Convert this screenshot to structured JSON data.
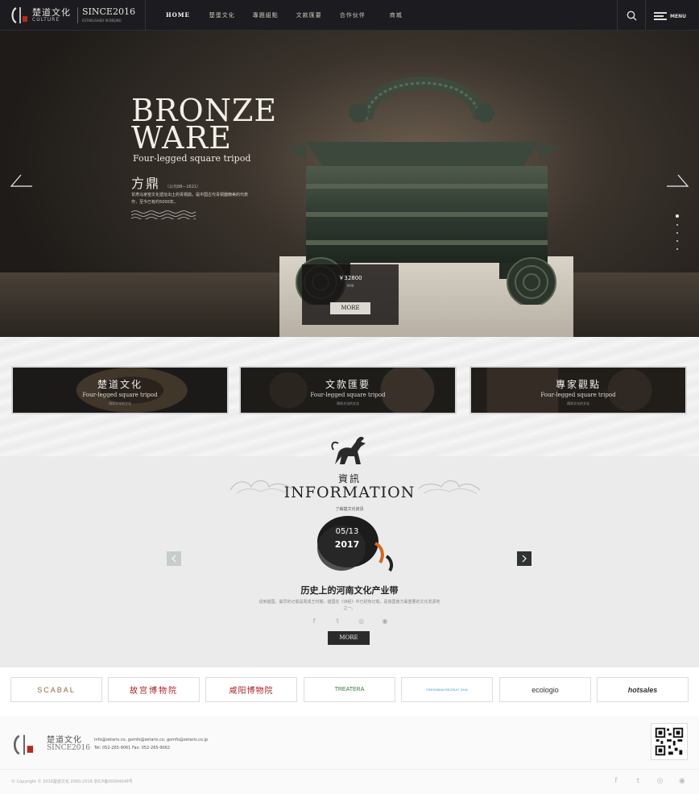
{
  "header": {
    "logo_cn": "楚道文化",
    "logo_en": "CULTURE",
    "logo_since": "SINCE2016",
    "logo_since_sub": "ESTABLISHED IN BEIJING",
    "nav": [
      {
        "label": "HOME",
        "active": true
      },
      {
        "label": "楚蛋文化"
      },
      {
        "label": "專題組點"
      },
      {
        "label": "文款匯要"
      },
      {
        "label": "合作伙伴"
      },
      {
        "label": "商城"
      }
    ],
    "search_icon": "search-icon",
    "menu_label": "MENU"
  },
  "hero": {
    "title_line1": "BRONZE",
    "title_line2": "WARE",
    "subtitle": "Four-legged square tripod",
    "name_cn": "方鼎",
    "period": "（公元88—1621）",
    "description": "甘肃马家窑文化遗址出土的青铜鼎，是中国古代青铜器精美的代表作，至今已有约5000年。",
    "price": "￥32800",
    "price_unit": "RMB",
    "more_label": "MORE",
    "slide_index": 0,
    "slide_count": 5
  },
  "categories": [
    {
      "title": "楚道文化",
      "subtitle": "Four-legged square tripod",
      "caption": "傳承文化的文化"
    },
    {
      "title": "文款匯要",
      "subtitle": "Four-legged square tripod",
      "caption": "傳承文化的文化"
    },
    {
      "title": "專家觀點",
      "subtitle": "Four-legged square tripod",
      "caption": "傳承文化的文化"
    }
  ],
  "information": {
    "heading_cn": "資訊",
    "heading_en": "INFORMATION",
    "tagline": "了解楚文化資訊",
    "date_md": "05/13",
    "date_year": "2017",
    "news_title": "历史上的河南文化产业带",
    "news_desc": "说到楚国，最早的记载是周成王时期，楚国在《诗经》中已经有记载，是我国南方最重要的文化发源地之一。",
    "more_label": "MORE",
    "social_icons": [
      "facebook-icon",
      "twitter-icon",
      "wechat-icon",
      "weibo-icon"
    ]
  },
  "partners": [
    {
      "name": "SCABAL",
      "color": "#8a6a3a"
    },
    {
      "name": "故宫博物院",
      "color": "#b02020"
    },
    {
      "name": "咸阳博物院",
      "color": "#b02020"
    },
    {
      "name": "TREATERA",
      "color": "#2f7a3a"
    },
    {
      "name": "FRESHMAN RECRUIT 2016",
      "color": "#2aa0c8"
    },
    {
      "name": "ecologio",
      "color": "#333333"
    },
    {
      "name": "hotsales",
      "color": "#333333"
    }
  ],
  "footer": {
    "logo_cn": "楚道文化",
    "logo_since": "SINCE2016",
    "emails": "info@zetaris.co,   gomfo@zetaris.co,   gomfo@zetaris.co.jp",
    "phone": "Tel: 052-265-9061  Fax: 052-265-9062",
    "copyright": "© Copyright © 2016楚道文化 2000-2016 京ICP备00004048号"
  },
  "colors": {
    "header_bg": "#1c1b1f",
    "accent": "#2b2b2b",
    "info_bg": "#ebebeb"
  }
}
